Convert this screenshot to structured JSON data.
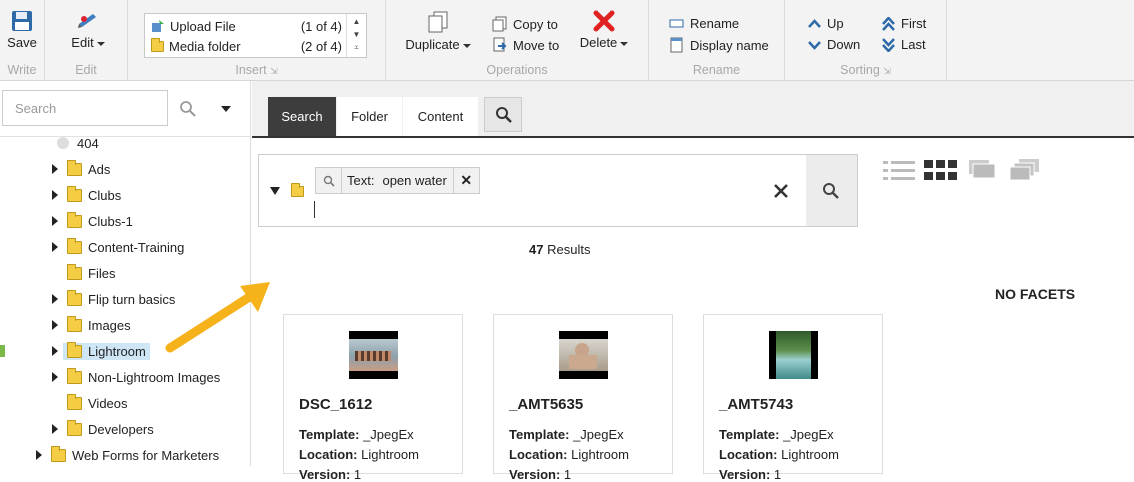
{
  "ribbon": {
    "write": {
      "save_label": "Save",
      "group_label": "Write"
    },
    "edit": {
      "edit_label": "Edit",
      "group_label": "Edit"
    },
    "insert": {
      "items": [
        {
          "label": "Upload File",
          "count": "(1 of 4)"
        },
        {
          "label": "Media folder",
          "count": "(2 of 4)"
        }
      ],
      "group_label": "Insert"
    },
    "operations": {
      "duplicate_label": "Duplicate",
      "copy_to_label": "Copy to",
      "move_to_label": "Move to",
      "delete_label": "Delete",
      "group_label": "Operations"
    },
    "rename": {
      "rename_label": "Rename",
      "display_name_label": "Display name",
      "group_label": "Rename"
    },
    "sorting": {
      "up_label": "Up",
      "down_label": "Down",
      "first_label": "First",
      "last_label": "Last",
      "group_label": "Sorting"
    }
  },
  "sidebar": {
    "search_placeholder": "Search",
    "tree": [
      {
        "label": "404",
        "expandable": false,
        "icon": "page-icon"
      },
      {
        "label": "Ads",
        "expandable": true
      },
      {
        "label": "Clubs",
        "expandable": true
      },
      {
        "label": "Clubs-1",
        "expandable": true
      },
      {
        "label": "Content-Training",
        "expandable": true
      },
      {
        "label": "Files",
        "expandable": false
      },
      {
        "label": "Flip turn basics",
        "expandable": true
      },
      {
        "label": "Images",
        "expandable": true
      },
      {
        "label": "Lightroom",
        "expandable": true,
        "selected": true
      },
      {
        "label": "Non-Lightroom Images",
        "expandable": true
      },
      {
        "label": "Videos",
        "expandable": false
      },
      {
        "label": "Developers",
        "expandable": true
      },
      {
        "label": "Web Forms for Marketers",
        "expandable": true
      }
    ]
  },
  "main": {
    "tabs": [
      {
        "label": "Search",
        "active": true
      },
      {
        "label": "Folder",
        "active": false
      },
      {
        "label": "Content",
        "active": false
      }
    ],
    "query": {
      "chip_key": "Text:",
      "chip_value": "open water"
    },
    "results_count": "47",
    "results_label": "Results",
    "no_facets": "NO FACETS",
    "cards": [
      {
        "title": "DSC_1612",
        "template": "_JpegEx",
        "location": "Lightroom",
        "version": "1"
      },
      {
        "title": "_AMT5635",
        "template": "_JpegEx",
        "location": "Lightroom",
        "version": "1"
      },
      {
        "title": "_AMT5743",
        "template": "_JpegEx",
        "location": "Lightroom",
        "version": "1"
      }
    ],
    "meta_labels": {
      "template": "Template:",
      "location": "Location:",
      "version": "Version:"
    }
  },
  "colors": {
    "accent_arrow": "#f5b21b",
    "active_tab": "#3d3d3d",
    "selected_tree": "#cfe6f6"
  }
}
